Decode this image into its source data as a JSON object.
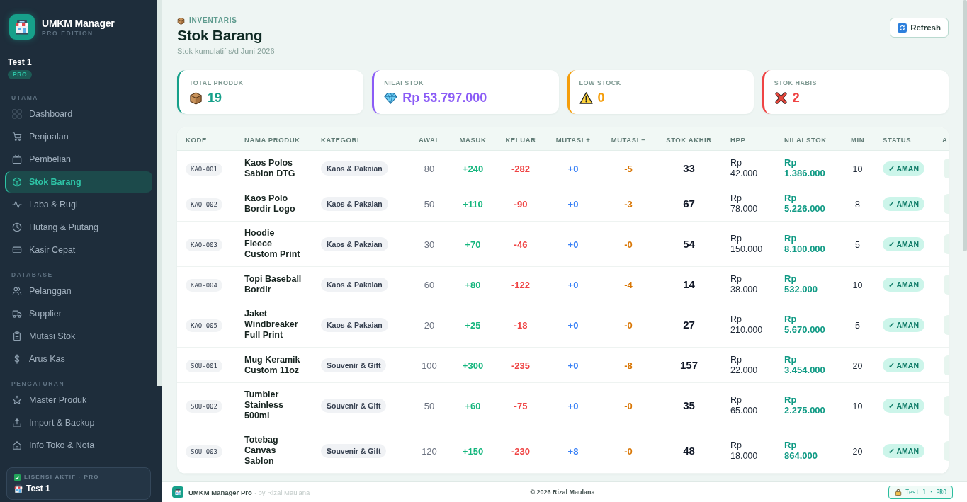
{
  "sidebar": {
    "brand": {
      "title": "UMKM Manager",
      "subtitle": "PRO EDITION"
    },
    "user": {
      "name": "Test 1",
      "badge": "PRO"
    },
    "sections": [
      {
        "label": "UTAMA",
        "items": [
          {
            "label": "Dashboard",
            "selected": false
          },
          {
            "label": "Penjualan",
            "selected": false
          },
          {
            "label": "Pembelian",
            "selected": false
          },
          {
            "label": "Stok Barang",
            "selected": true
          },
          {
            "label": "Laba & Rugi",
            "selected": false
          },
          {
            "label": "Hutang & Piutang",
            "selected": false
          },
          {
            "label": "Kasir Cepat",
            "selected": false
          }
        ]
      },
      {
        "label": "DATABASE",
        "items": [
          {
            "label": "Pelanggan",
            "selected": false
          },
          {
            "label": "Supplier",
            "selected": false
          },
          {
            "label": "Mutasi Stok",
            "selected": false
          },
          {
            "label": "Arus Kas",
            "selected": false
          }
        ]
      },
      {
        "label": "PENGATURAN",
        "items": [
          {
            "label": "Master Produk",
            "selected": false
          },
          {
            "label": "Import & Backup",
            "selected": false
          },
          {
            "label": "Info Toko & Nota",
            "selected": false
          }
        ]
      }
    ],
    "license": {
      "label": "LISENSI AKTIF · PRO",
      "name": "Test 1"
    }
  },
  "header": {
    "eyebrow": "INVENTARIS",
    "title": "Stok Barang",
    "subtitle": "Stok kumulatif s/d Juni 2026",
    "refresh_button": "Refresh"
  },
  "stat_cards": [
    {
      "label": "TOTAL PRODUK",
      "value": "19",
      "color": "#16a08a"
    },
    {
      "label": "NILAI STOK",
      "value": "Rp 53.797.000",
      "color": "#8b5cf6"
    },
    {
      "label": "LOW STOCK",
      "value": "0",
      "color": "#f59e0b"
    },
    {
      "label": "STOK HABIS",
      "value": "2",
      "color": "#ef4444"
    }
  ],
  "table": {
    "columns": [
      "KODE",
      "NAMA PRODUK",
      "KATEGORI",
      "AWAL",
      "MASUK",
      "KELUAR",
      "MUTASI +",
      "MUTASI −",
      "STOK AKHIR",
      "HPP",
      "NILAI STOK",
      "MIN",
      "STATUS",
      "A"
    ],
    "rows": [
      {
        "code": "KAO-001",
        "name": "Kaos Polos Sablon DTG",
        "category": "Kaos & Pakaian",
        "start": "80",
        "in": "+240",
        "out": "-282",
        "mutation_plus": "+0",
        "mutation_minus": "-5",
        "final": "33",
        "hpp": "Rp 42.000",
        "stock_value": "Rp 1.386.000",
        "min": "10",
        "status": "✓ AMAN"
      },
      {
        "code": "KAO-002",
        "name": "Kaos Polo Bordir Logo",
        "category": "Kaos & Pakaian",
        "start": "50",
        "in": "+110",
        "out": "-90",
        "mutation_plus": "+0",
        "mutation_minus": "-3",
        "final": "67",
        "hpp": "Rp 78.000",
        "stock_value": "Rp 5.226.000",
        "min": "8",
        "status": "✓ AMAN"
      },
      {
        "code": "KAO-003",
        "name": "Hoodie Fleece Custom Print",
        "category": "Kaos & Pakaian",
        "start": "30",
        "in": "+70",
        "out": "-46",
        "mutation_plus": "+0",
        "mutation_minus": "-0",
        "final": "54",
        "hpp": "Rp 150.000",
        "stock_value": "Rp 8.100.000",
        "min": "5",
        "status": "✓ AMAN"
      },
      {
        "code": "KAO-004",
        "name": "Topi Baseball Bordir",
        "category": "Kaos & Pakaian",
        "start": "60",
        "in": "+80",
        "out": "-122",
        "mutation_plus": "+0",
        "mutation_minus": "-4",
        "final": "14",
        "hpp": "Rp 38.000",
        "stock_value": "Rp 532.000",
        "min": "10",
        "status": "✓ AMAN"
      },
      {
        "code": "KAO-005",
        "name": "Jaket Windbreaker Full Print",
        "category": "Kaos & Pakaian",
        "start": "20",
        "in": "+25",
        "out": "-18",
        "mutation_plus": "+0",
        "mutation_minus": "-0",
        "final": "27",
        "hpp": "Rp 210.000",
        "stock_value": "Rp 5.670.000",
        "min": "5",
        "status": "✓ AMAN"
      },
      {
        "code": "SOU-001",
        "name": "Mug Keramik Custom 11oz",
        "category": "Souvenir & Gift",
        "start": "100",
        "in": "+300",
        "out": "-235",
        "mutation_plus": "+0",
        "mutation_minus": "-8",
        "final": "157",
        "hpp": "Rp 22.000",
        "stock_value": "Rp 3.454.000",
        "min": "20",
        "status": "✓ AMAN"
      },
      {
        "code": "SOU-002",
        "name": "Tumbler Stainless 500ml",
        "category": "Souvenir & Gift",
        "start": "50",
        "in": "+60",
        "out": "-75",
        "mutation_plus": "+0",
        "mutation_minus": "-0",
        "final": "35",
        "hpp": "Rp 65.000",
        "stock_value": "Rp 2.275.000",
        "min": "10",
        "status": "✓ AMAN"
      },
      {
        "code": "SOU-003",
        "name": "Totebag Canvas Sablon",
        "category": "Souvenir & Gift",
        "start": "120",
        "in": "+150",
        "out": "-230",
        "mutation_plus": "+8",
        "mutation_minus": "-0",
        "final": "48",
        "hpp": "Rp 18.000",
        "stock_value": "Rp 864.000",
        "min": "20",
        "status": "✓ AMAN"
      }
    ]
  },
  "footer": {
    "app": "UMKM Manager Pro",
    "credit": "· by Rizal Maulana",
    "copyright": "© 2026 Rizal Maulana",
    "badge": "Test 1 · PRO"
  }
}
